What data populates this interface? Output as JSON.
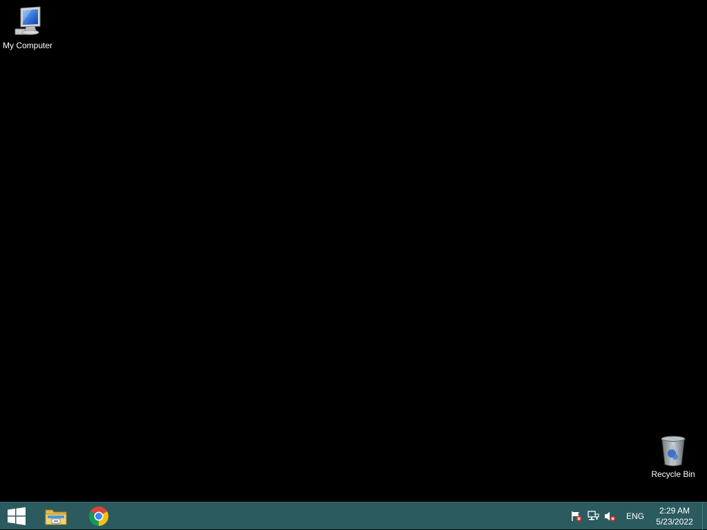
{
  "desktop": {
    "icons": [
      {
        "label": "My Computer",
        "icon": "computer-icon"
      },
      {
        "label": "Recycle Bin",
        "icon": "recycle-bin-icon"
      }
    ]
  },
  "taskbar": {
    "color": "#2b5b5e",
    "start_icon": "windows-logo-icon",
    "pinned": [
      {
        "icon": "file-explorer-icon"
      },
      {
        "icon": "chrome-icon"
      }
    ],
    "tray": {
      "icons": [
        "action-center-flag-icon",
        "network-icon",
        "volume-muted-icon"
      ],
      "language": "ENG",
      "time": "2:29 AM",
      "date": "5/23/2022"
    }
  }
}
